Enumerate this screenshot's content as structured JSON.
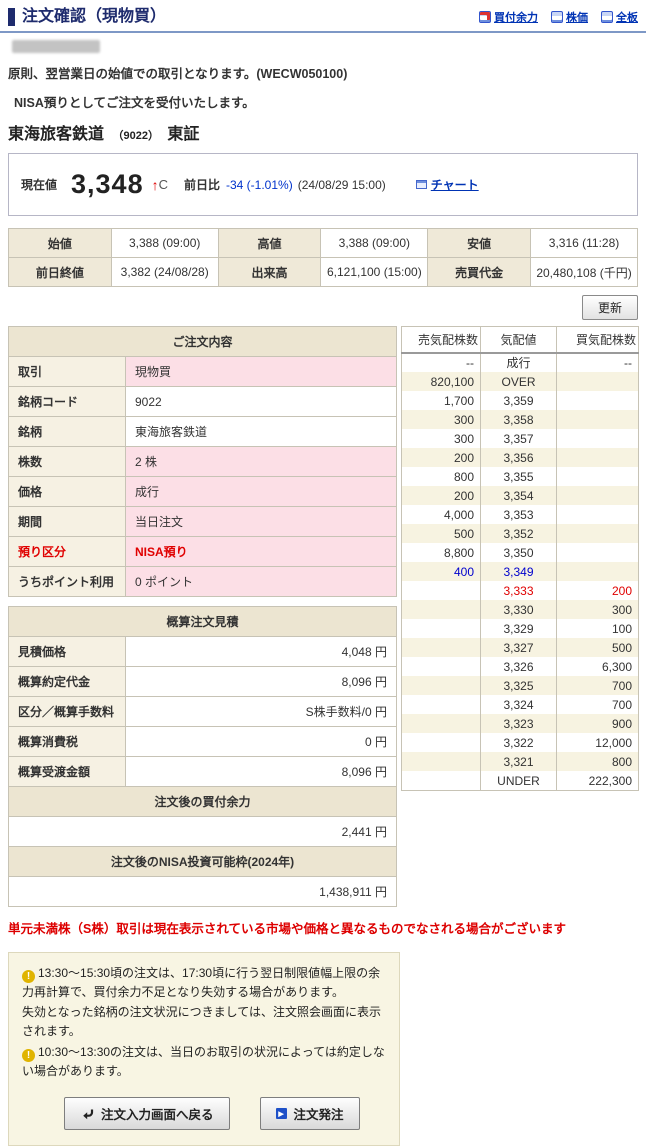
{
  "header": {
    "title": "注文確認（現物買）",
    "links": [
      {
        "label": "買付余力",
        "icon": "buying-power-icon"
      },
      {
        "label": "株価",
        "icon": "stock-price-icon"
      },
      {
        "label": "全板",
        "icon": "full-board-icon"
      }
    ]
  },
  "messages": {
    "rule": "原則、翌営業日の始値での取引となります。(WECW050100)",
    "nisa": "NISA預りとしてご注文を受付いたします。"
  },
  "stock": {
    "name": "東海旅客鉄道",
    "code": "（9022）",
    "market": "東証"
  },
  "quote": {
    "label": "現在値",
    "price": "3,348",
    "arrow": "↑",
    "arrow_suffix": "C",
    "change_label": "前日比",
    "change": "-34 (-1.01%)",
    "time": "(24/08/29 15:00)",
    "chart_label": "チャート"
  },
  "stats": {
    "rows": [
      [
        {
          "label": "始値",
          "value": "3,388 (09:00)"
        },
        {
          "label": "高値",
          "value": "3,388 (09:00)"
        },
        {
          "label": "安値",
          "value": "3,316 (11:28)"
        }
      ],
      [
        {
          "label": "前日終値",
          "value": "3,382 (24/08/28)"
        },
        {
          "label": "出来高",
          "value": "6,121,100 (15:00)"
        },
        {
          "label": "売買代金",
          "value": "20,480,108 (千円)"
        }
      ]
    ]
  },
  "refresh_label": "更新",
  "order": {
    "title": "ご注文内容",
    "rows": [
      {
        "label": "取引",
        "value": "現物買",
        "pink": true,
        "red": false
      },
      {
        "label": "銘柄コード",
        "value": "9022",
        "pink": false,
        "red": false
      },
      {
        "label": "銘柄",
        "value": "東海旅客鉄道",
        "pink": false,
        "red": false
      },
      {
        "label": "株数",
        "value": "2 株",
        "pink": true,
        "red": false
      },
      {
        "label": "価格",
        "value": "成行",
        "pink": true,
        "red": false
      },
      {
        "label": "期間",
        "value": "当日注文",
        "pink": true,
        "red": false
      },
      {
        "label": "預り区分",
        "value": "NISA預り",
        "pink": true,
        "red": true
      },
      {
        "label": "うちポイント利用",
        "value": "0 ポイント",
        "pink": true,
        "red": false
      }
    ]
  },
  "estimate": {
    "title": "概算注文見積",
    "rows": [
      {
        "label": "見積価格",
        "value": "4,048 円"
      },
      {
        "label": "概算約定代金",
        "value": "8,096 円"
      },
      {
        "label": "区分／概算手数料",
        "value": "S株手数料/0 円"
      },
      {
        "label": "概算消費税",
        "value": "0 円"
      },
      {
        "label": "概算受渡金額",
        "value": "8,096 円"
      }
    ],
    "after_sections": [
      {
        "title": "注文後の買付余力",
        "value": "2,441 円"
      },
      {
        "title": "注文後のNISA投資可能枠(2024年)",
        "value": "1,438,911 円"
      }
    ]
  },
  "warning": "単元未満株（S株）取引は現在表示されている市場や価格と異なるものでなされる場合がございます",
  "notes": [
    {
      "icon": true,
      "text": "13:30～15:30頃の注文は、17:30頃に行う翌日制限値幅上限の余力再計算で、買付余力不足となり失効する場合があります。"
    },
    {
      "icon": false,
      "text": "失効となった銘柄の注文状況につきましては、注文照会画面に表示されます。"
    },
    {
      "icon": true,
      "text": "10:30～13:30の注文は、当日のお取引の状況によっては約定しない場合があります。"
    }
  ],
  "buttons": {
    "back": "注文入力画面へ戻る",
    "submit": "注文発注"
  },
  "orderbook": {
    "headers": [
      "売気配株数",
      "気配値",
      "買気配株数"
    ],
    "rows": [
      {
        "sell": "--",
        "price": "成行",
        "buy": "--",
        "cls": ""
      },
      {
        "sell": "820,100",
        "price": "OVER",
        "buy": "",
        "cls": ""
      },
      {
        "sell": "1,700",
        "price": "3,359",
        "buy": "",
        "cls": ""
      },
      {
        "sell": "300",
        "price": "3,358",
        "buy": "",
        "cls": ""
      },
      {
        "sell": "300",
        "price": "3,357",
        "buy": "",
        "cls": ""
      },
      {
        "sell": "200",
        "price": "3,356",
        "buy": "",
        "cls": ""
      },
      {
        "sell": "800",
        "price": "3,355",
        "buy": "",
        "cls": ""
      },
      {
        "sell": "200",
        "price": "3,354",
        "buy": "",
        "cls": ""
      },
      {
        "sell": "4,000",
        "price": "3,353",
        "buy": "",
        "cls": ""
      },
      {
        "sell": "500",
        "price": "3,352",
        "buy": "",
        "cls": ""
      },
      {
        "sell": "8,800",
        "price": "3,350",
        "buy": "",
        "cls": ""
      },
      {
        "sell": "400",
        "price": "3,349",
        "buy": "",
        "cls": "blue"
      },
      {
        "sell": "",
        "price": "3,333",
        "buy": "200",
        "cls": "red"
      },
      {
        "sell": "",
        "price": "3,330",
        "buy": "300",
        "cls": ""
      },
      {
        "sell": "",
        "price": "3,329",
        "buy": "100",
        "cls": ""
      },
      {
        "sell": "",
        "price": "3,327",
        "buy": "500",
        "cls": ""
      },
      {
        "sell": "",
        "price": "3,326",
        "buy": "6,300",
        "cls": ""
      },
      {
        "sell": "",
        "price": "3,325",
        "buy": "700",
        "cls": ""
      },
      {
        "sell": "",
        "price": "3,324",
        "buy": "700",
        "cls": ""
      },
      {
        "sell": "",
        "price": "3,323",
        "buy": "900",
        "cls": ""
      },
      {
        "sell": "",
        "price": "3,322",
        "buy": "12,000",
        "cls": ""
      },
      {
        "sell": "",
        "price": "3,321",
        "buy": "800",
        "cls": ""
      },
      {
        "sell": "",
        "price": "UNDER",
        "buy": "222,300",
        "cls": ""
      }
    ]
  }
}
